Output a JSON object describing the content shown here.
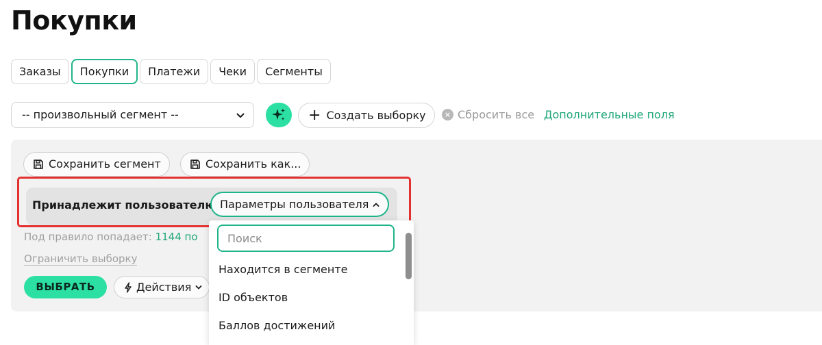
{
  "page": {
    "title": "Покупки"
  },
  "tabs": [
    {
      "label": "Заказы",
      "active": false
    },
    {
      "label": "Покупки",
      "active": true
    },
    {
      "label": "Платежи",
      "active": false
    },
    {
      "label": "Чеки",
      "active": false
    },
    {
      "label": "Сегменты",
      "active": false
    }
  ],
  "filters": {
    "segment_select_value": "-- произвольный сегмент --",
    "create_label": "Создать выборку",
    "reset_label": "Сбросить все",
    "extra_fields_label": "Дополнительные поля"
  },
  "panel": {
    "save_segment_label": "Сохранить сегмент",
    "save_as_label": "Сохранить как...",
    "rule": {
      "label": "Принадлежит пользователю",
      "param_label": "Параметры пользователя"
    },
    "count_prefix": "Под правило попадает:",
    "count_value": "1144 по",
    "limit_label": "Ограничить выборку",
    "select_label": "ВЫБРАТЬ",
    "actions_label": "Действия"
  },
  "dropdown": {
    "search_placeholder": "Поиск",
    "items": [
      "Находится в сегменте",
      "ID объектов",
      "Баллов достижений"
    ]
  },
  "colors": {
    "accent": "#2be0a2",
    "accent_dark": "#1fb58a",
    "highlight_border": "#e53030",
    "panel_bg": "#f2f2f2"
  }
}
